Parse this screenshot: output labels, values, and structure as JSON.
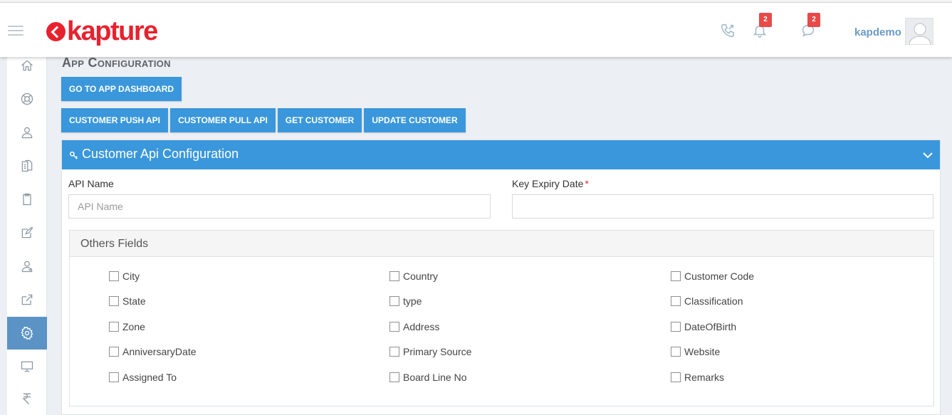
{
  "app": {
    "logo_text": "kapture",
    "brand_color": "#e8212e",
    "accent_color": "#3a97dc"
  },
  "header": {
    "calls_icon": "phone-icon",
    "notifications_count": "2",
    "messages_count": "2",
    "username": "kapdemo"
  },
  "sidebar": {
    "items": [
      {
        "icon": "home-icon",
        "active": false
      },
      {
        "icon": "lifebuoy-icon",
        "active": false
      },
      {
        "icon": "user-icon",
        "active": false
      },
      {
        "icon": "documents-icon",
        "active": false
      },
      {
        "icon": "clipboard-icon",
        "active": false
      },
      {
        "icon": "edit-icon",
        "active": false
      },
      {
        "icon": "users-icon",
        "active": false
      },
      {
        "icon": "share-icon",
        "active": false
      },
      {
        "icon": "settings-icon",
        "active": true
      },
      {
        "icon": "monitor-icon",
        "active": false
      },
      {
        "icon": "rupee-icon",
        "active": false
      }
    ]
  },
  "page": {
    "title": "App Configuration",
    "dashboard_button": "Go to App Dashboard",
    "tabs": [
      "Customer Push API",
      "Customer Pull API",
      "Get Customer",
      "Update Customer"
    ]
  },
  "panel": {
    "title": "Customer Api Configuration",
    "api_name_label": "API Name",
    "api_name_placeholder": "API Name",
    "api_name_value": "",
    "key_expiry_label": "Key Expiry Date",
    "key_expiry_required": "*",
    "key_expiry_value": "",
    "others_title": "Others Fields",
    "columns": [
      [
        "City",
        "State",
        "Zone",
        "AnniversaryDate",
        "Assigned To"
      ],
      [
        "Country",
        "type",
        "Address",
        "Primary Source",
        "Board Line No"
      ],
      [
        "Customer Code",
        "Classification",
        "DateOfBirth",
        "Website",
        "Remarks"
      ]
    ]
  }
}
